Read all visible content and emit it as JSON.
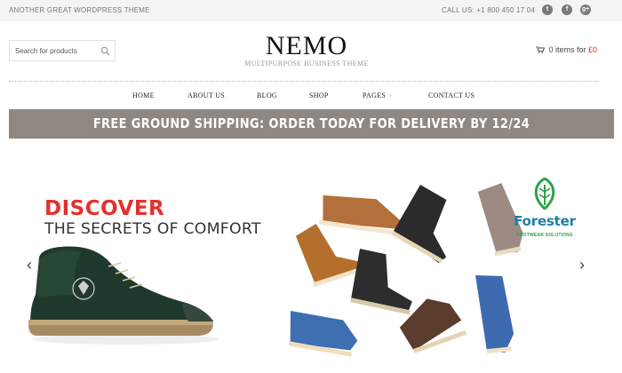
{
  "topbar": {
    "tagline": "ANOTHER GREAT WORDPRESS THEME",
    "phone": "CALL US: +1 800 450 17 04",
    "social": [
      {
        "icon": "twitter-icon",
        "glyph": "t"
      },
      {
        "icon": "facebook-icon",
        "glyph": "f"
      },
      {
        "icon": "google-plus-icon",
        "glyph": "g+"
      }
    ]
  },
  "header": {
    "search_placeholder": "Search for products",
    "logo_title": "NEMO",
    "logo_subtitle": "MULTIPURPOSE BUSINESS THEME",
    "cart_count_text": "0 items for",
    "cart_price": "£0"
  },
  "nav": {
    "items": [
      {
        "label": "HOME"
      },
      {
        "label": "ABOUT US"
      },
      {
        "label": "BLOG"
      },
      {
        "label": "SHOP"
      },
      {
        "label": "PAGES",
        "chevron": "›"
      },
      {
        "label": "CONTACT US"
      }
    ]
  },
  "banner": {
    "text": "FREE GROUND SHIPPING: ORDER TODAY FOR DELIVERY BY 12/24"
  },
  "slider": {
    "headline": "DISCOVER",
    "subheadline": "THE SECRETS OF COMFORT",
    "prev_arrow": "‹",
    "next_arrow": "›",
    "brand_name": "Forester",
    "brand_tagline": "FOOTWEAR SOLUTIONS"
  },
  "colors": {
    "accent_red": "#e3312c",
    "banner_bg": "#8f8781",
    "brand_blue": "#1f7fa7",
    "brand_green": "#2fa24a"
  }
}
